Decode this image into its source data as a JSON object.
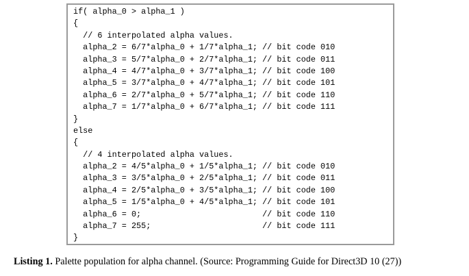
{
  "listing": {
    "lines": [
      "if( alpha_0 > alpha_1 )",
      "{",
      "  // 6 interpolated alpha values.",
      "  alpha_2 = 6/7*alpha_0 + 1/7*alpha_1; // bit code 010",
      "  alpha_3 = 5/7*alpha_0 + 2/7*alpha_1; // bit code 011",
      "  alpha_4 = 4/7*alpha_0 + 3/7*alpha_1; // bit code 100",
      "  alpha_5 = 3/7*alpha_0 + 4/7*alpha_1; // bit code 101",
      "  alpha_6 = 2/7*alpha_0 + 5/7*alpha_1; // bit code 110",
      "  alpha_7 = 1/7*alpha_0 + 6/7*alpha_1; // bit code 111",
      "}",
      "else",
      "{",
      "  // 4 interpolated alpha values.",
      "  alpha_2 = 4/5*alpha_0 + 1/5*alpha_1; // bit code 010",
      "  alpha_3 = 3/5*alpha_0 + 2/5*alpha_1; // bit code 011",
      "  alpha_4 = 2/5*alpha_0 + 3/5*alpha_1; // bit code 100",
      "  alpha_5 = 1/5*alpha_0 + 4/5*alpha_1; // bit code 101",
      "  alpha_6 = 0;                         // bit code 110",
      "  alpha_7 = 255;                       // bit code 111",
      "}"
    ]
  },
  "caption": {
    "label": "Listing 1.",
    "text": " Palette population for alpha channel. (Source: Programming Guide for Direct3D 10 (27))"
  }
}
